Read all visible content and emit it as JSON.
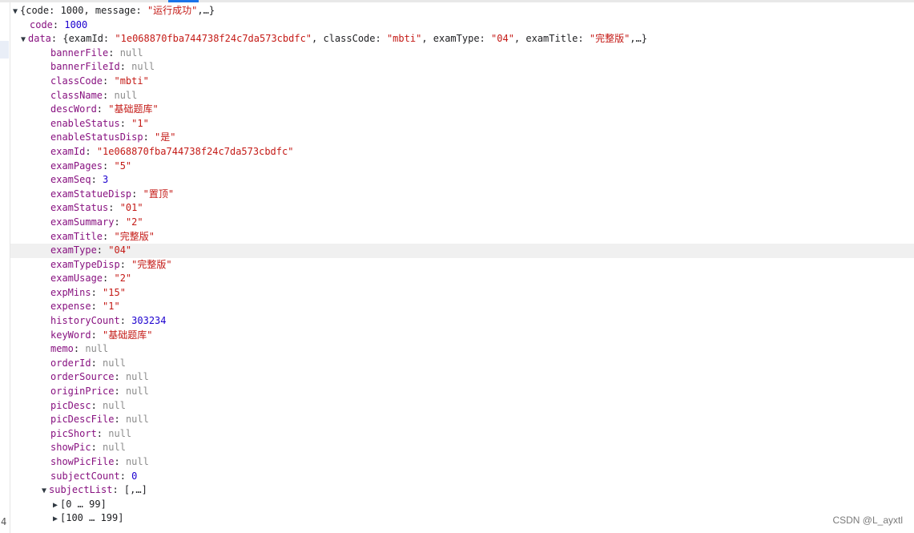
{
  "root": {
    "summary_open": "{code: 1000, message: ",
    "message": "\"运行成功\"",
    "summary_close": ",…}"
  },
  "code": {
    "key": "code",
    "value": "1000"
  },
  "data_row": {
    "key": "data",
    "p1": ": {examId: ",
    "examId": "\"1e068870fba744738f24c7da573cbdfc\"",
    "p2": ", classCode: ",
    "classCode": "\"mbti\"",
    "p3": ", examType: ",
    "examType": "\"04\"",
    "p4": ", examTitle: ",
    "examTitle": "\"完整版\"",
    "p5": ",…}"
  },
  "fields": [
    {
      "key": "bannerFile",
      "value": "null",
      "type": "null"
    },
    {
      "key": "bannerFileId",
      "value": "null",
      "type": "null"
    },
    {
      "key": "classCode",
      "value": "\"mbti\"",
      "type": "string"
    },
    {
      "key": "className",
      "value": "null",
      "type": "null"
    },
    {
      "key": "descWord",
      "value": "\"基础题库\"",
      "type": "string"
    },
    {
      "key": "enableStatus",
      "value": "\"1\"",
      "type": "string"
    },
    {
      "key": "enableStatusDisp",
      "value": "\"是\"",
      "type": "string"
    },
    {
      "key": "examId",
      "value": "\"1e068870fba744738f24c7da573cbdfc\"",
      "type": "string"
    },
    {
      "key": "examPages",
      "value": "\"5\"",
      "type": "string"
    },
    {
      "key": "examSeq",
      "value": "3",
      "type": "number"
    },
    {
      "key": "examStatueDisp",
      "value": "\"置顶\"",
      "type": "string"
    },
    {
      "key": "examStatus",
      "value": "\"01\"",
      "type": "string"
    },
    {
      "key": "examSummary",
      "value": "\"2\"",
      "type": "string"
    },
    {
      "key": "examTitle",
      "value": "\"完整版\"",
      "type": "string"
    },
    {
      "key": "examType",
      "value": "\"04\"",
      "type": "string"
    },
    {
      "key": "examTypeDisp",
      "value": "\"完整版\"",
      "type": "string"
    },
    {
      "key": "examUsage",
      "value": "\"2\"",
      "type": "string"
    },
    {
      "key": "expMins",
      "value": "\"15\"",
      "type": "string"
    },
    {
      "key": "expense",
      "value": "\"1\"",
      "type": "string"
    },
    {
      "key": "historyCount",
      "value": "303234",
      "type": "number"
    },
    {
      "key": "keyWord",
      "value": "\"基础题库\"",
      "type": "string"
    },
    {
      "key": "memo",
      "value": "null",
      "type": "null"
    },
    {
      "key": "orderId",
      "value": "null",
      "type": "null"
    },
    {
      "key": "orderSource",
      "value": "null",
      "type": "null"
    },
    {
      "key": "originPrice",
      "value": "null",
      "type": "null"
    },
    {
      "key": "picDesc",
      "value": "null",
      "type": "null"
    },
    {
      "key": "picDescFile",
      "value": "null",
      "type": "null"
    },
    {
      "key": "picShort",
      "value": "null",
      "type": "null"
    },
    {
      "key": "showPic",
      "value": "null",
      "type": "null"
    },
    {
      "key": "showPicFile",
      "value": "null",
      "type": "null"
    },
    {
      "key": "subjectCount",
      "value": "0",
      "type": "number"
    }
  ],
  "subjectList": {
    "key": "subjectList",
    "summary": ": [,…]"
  },
  "ranges": [
    {
      "label": "[0 … 99]"
    },
    {
      "label": "[100 … 199]"
    }
  ],
  "gutter": {
    "line": "4"
  },
  "watermark": "CSDN @L_ayxtl",
  "colors": {
    "key": "#881280",
    "string": "#c41a16",
    "number": "#1c00cf",
    "null": "#8c8c8c",
    "highlight": "#f0f0f0"
  }
}
